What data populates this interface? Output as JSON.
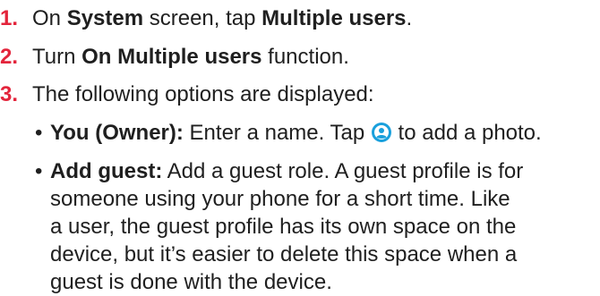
{
  "steps": [
    {
      "num": "1.",
      "p1": "On ",
      "b1": "System",
      "p2": " screen, tap ",
      "b2": "Multiple users",
      "p3": "."
    },
    {
      "num": "2.",
      "p1": "Turn ",
      "b1": "On Multiple users",
      "p2": " function."
    },
    {
      "num": "3.",
      "text": "The following options are displayed:"
    }
  ],
  "bullets": [
    {
      "dot": "•",
      "label": "You (Owner):",
      "text_before_icon": " Enter a name. Tap ",
      "icon": "user-avatar-icon",
      "text_after_icon": " to add a photo."
    },
    {
      "dot": "•",
      "label": "Add guest:",
      "lines": [
        " Add a guest role. A guest profile is for",
        "someone using your phone for a short time. Like",
        "a user, the guest profile has its own space on the",
        "device, but it’s easier to delete this space when a",
        "guest is done with the device."
      ]
    }
  ],
  "colors": {
    "step_number": "#e3243b",
    "icon": "#1aa0dc",
    "text": "#1f1f1f"
  }
}
